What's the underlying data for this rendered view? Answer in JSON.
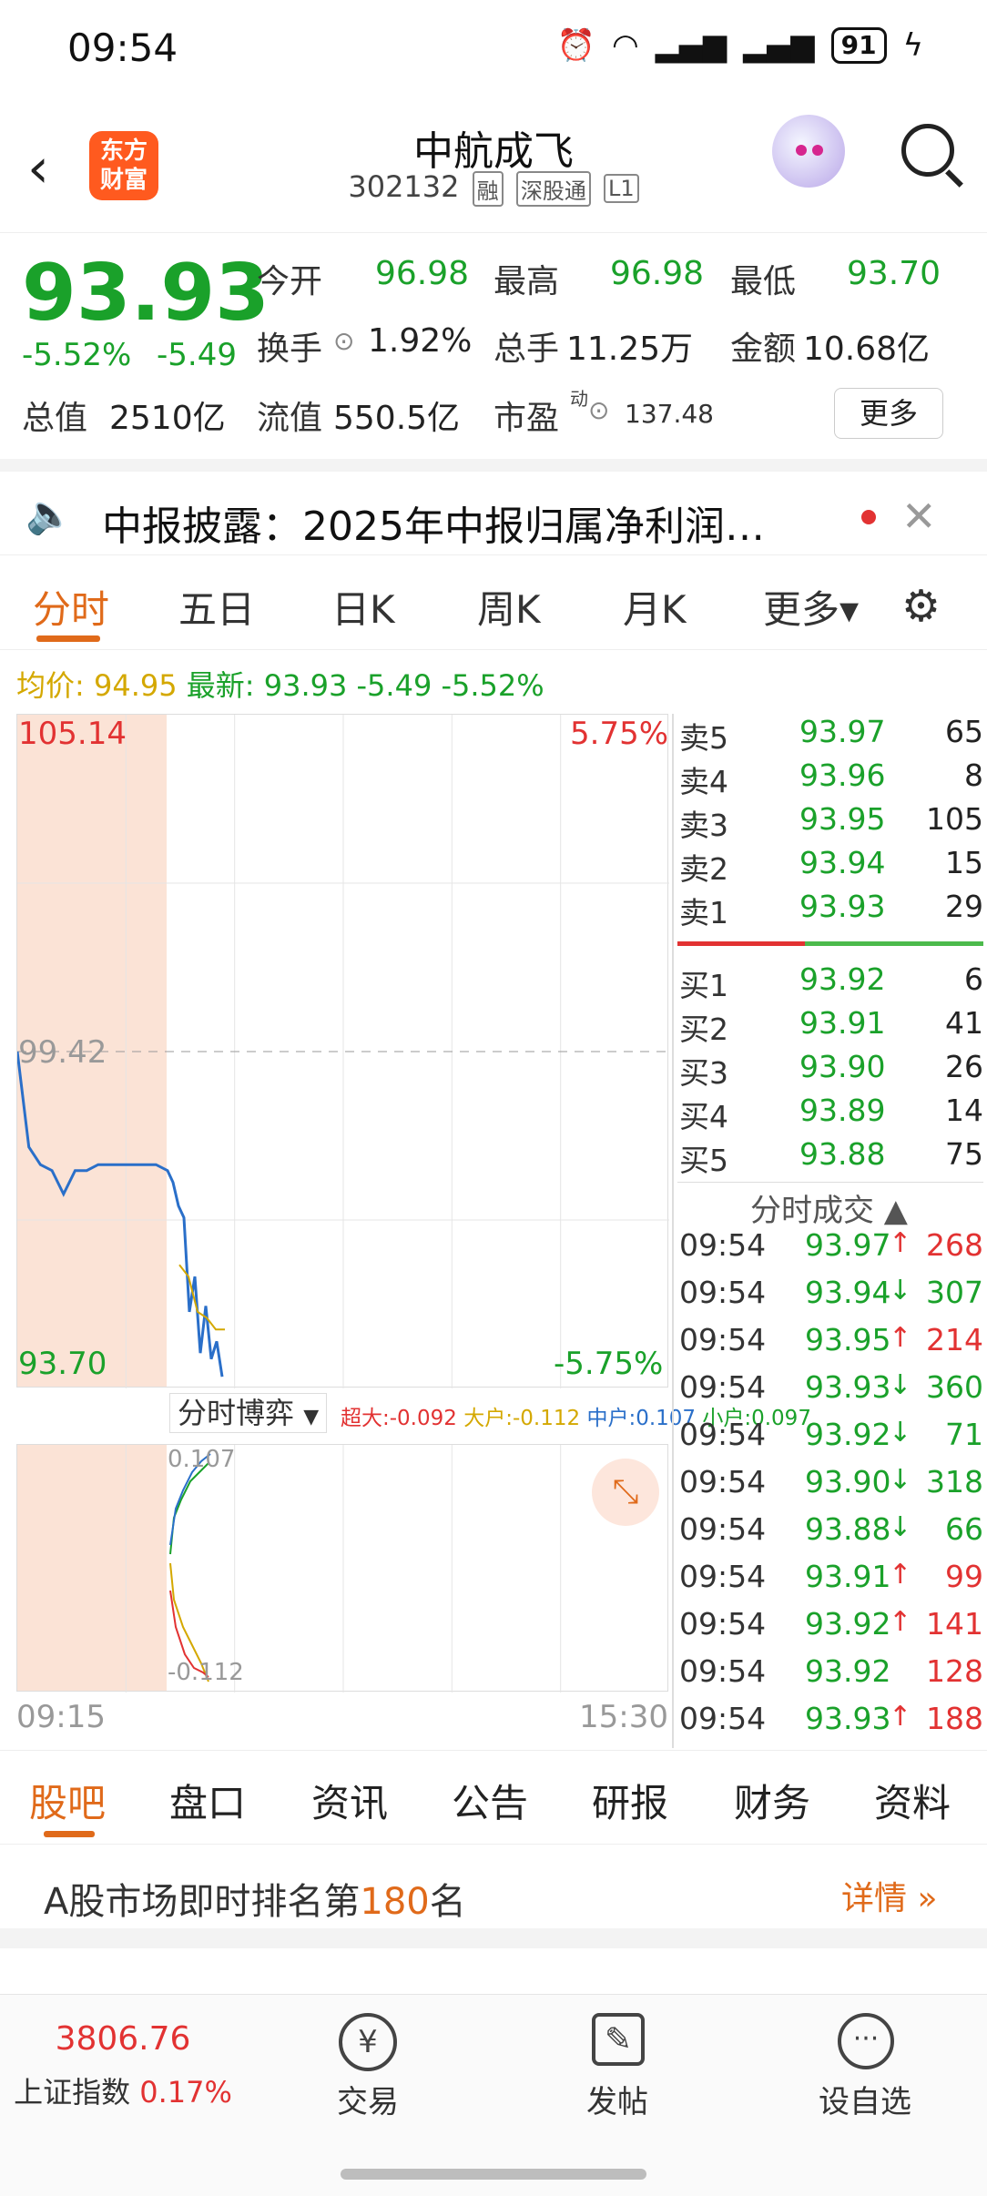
{
  "status_bar": {
    "time": "09:54",
    "battery": "91"
  },
  "header": {
    "logo_text_top": "东方",
    "logo_text_bottom": "财富",
    "stock_name": "中航成飞",
    "stock_code": "302132",
    "tags": [
      "融",
      "深股通",
      "L1"
    ]
  },
  "quote": {
    "price": "93.93",
    "change_pct": "-5.52%",
    "change": "-5.49",
    "open_label": "今开",
    "open": "96.98",
    "high_label": "最高",
    "high": "96.98",
    "low_label": "最低",
    "low": "93.70",
    "turnover_label": "换手",
    "turnover": "1.92%",
    "volume_label": "总手",
    "volume": "11.25万",
    "amount_label": "金额",
    "amount": "10.68亿",
    "mktcap_label": "总值",
    "mktcap": "2510亿",
    "float_label": "流值",
    "float": "550.5亿",
    "pe_label": "市盈",
    "pe_sup": "动",
    "pe": "137.48",
    "more_button": "更多"
  },
  "notice": {
    "text": "中报披露：2025年中报归属净利润…"
  },
  "chart_tabs": {
    "items": [
      "分时",
      "五日",
      "日K",
      "周K",
      "月K",
      "更多▾"
    ],
    "active": "分时"
  },
  "avg_line": {
    "avg_label": "均价:",
    "avg": "94.95",
    "latest_label": "最新:",
    "latest": "93.93",
    "chg": "-5.49",
    "pct": "-5.52%"
  },
  "chart_data": {
    "type": "line",
    "y_top_label": "105.14",
    "y_mid_label": "99.42",
    "y_bottom_label": "93.70",
    "pct_top_label": "5.75%",
    "pct_bottom_label": "-5.75%",
    "x_start_label": "09:15",
    "x_end_label": "15:30",
    "ylim": [
      93.7,
      105.14
    ],
    "series": [
      {
        "values": [
          99.42,
          97.8,
          97.5,
          97.4,
          97.0,
          97.4,
          97.4,
          97.5,
          97.5,
          97.5,
          97.5,
          97.5,
          97.5,
          97.4,
          97.2,
          96.8,
          96.6,
          95.0,
          95.6,
          94.3,
          95.1,
          94.2,
          94.5,
          93.9
        ]
      },
      {
        "values": [
          95.8,
          95.6,
          95.0,
          94.9,
          94.7,
          94.7
        ]
      }
    ],
    "sub_panel": {
      "selector_label": "分时博弈",
      "legend": [
        {
          "name": "超大:",
          "value": "-0.092",
          "color": "#e23232"
        },
        {
          "name": "大户:",
          "value": "-0.112",
          "color": "#d4a800"
        },
        {
          "name": "中户:",
          "value": "0.107",
          "color": "#2a6fc9"
        },
        {
          "name": "小户:",
          "value": "0.097",
          "color": "#1aa12a"
        }
      ],
      "top_label": "0.107",
      "bottom_label": "-0.112"
    }
  },
  "order_book": {
    "asks": [
      {
        "label": "卖5",
        "price": "93.97",
        "vol": "65"
      },
      {
        "label": "卖4",
        "price": "93.96",
        "vol": "8"
      },
      {
        "label": "卖3",
        "price": "93.95",
        "vol": "105"
      },
      {
        "label": "卖2",
        "price": "93.94",
        "vol": "15"
      },
      {
        "label": "卖1",
        "price": "93.93",
        "vol": "29"
      }
    ],
    "bids": [
      {
        "label": "买1",
        "price": "93.92",
        "vol": "6"
      },
      {
        "label": "买2",
        "price": "93.91",
        "vol": "41"
      },
      {
        "label": "买3",
        "price": "93.90",
        "vol": "26"
      },
      {
        "label": "买4",
        "price": "93.89",
        "vol": "14"
      },
      {
        "label": "买5",
        "price": "93.88",
        "vol": "75"
      }
    ]
  },
  "ticks": {
    "title": "分时成交 ▲",
    "rows": [
      {
        "time": "09:54",
        "price": "93.97",
        "dir": "↑",
        "vol": "268",
        "color": "#e23232"
      },
      {
        "time": "09:54",
        "price": "93.94",
        "dir": "↓",
        "vol": "307",
        "color": "#1aa12a"
      },
      {
        "time": "09:54",
        "price": "93.95",
        "dir": "↑",
        "vol": "214",
        "color": "#e23232"
      },
      {
        "time": "09:54",
        "price": "93.93",
        "dir": "↓",
        "vol": "360",
        "color": "#1aa12a"
      },
      {
        "time": "09:54",
        "price": "93.92",
        "dir": "↓",
        "vol": "71",
        "color": "#1aa12a"
      },
      {
        "time": "09:54",
        "price": "93.90",
        "dir": "↓",
        "vol": "318",
        "color": "#1aa12a"
      },
      {
        "time": "09:54",
        "price": "93.88",
        "dir": "↓",
        "vol": "66",
        "color": "#1aa12a"
      },
      {
        "time": "09:54",
        "price": "93.91",
        "dir": "↑",
        "vol": "99",
        "color": "#e23232"
      },
      {
        "time": "09:54",
        "price": "93.92",
        "dir": "↑",
        "vol": "141",
        "color": "#e23232"
      },
      {
        "time": "09:54",
        "price": "93.92",
        "dir": "",
        "vol": "128",
        "color": "#e23232"
      },
      {
        "time": "09:54",
        "price": "93.93",
        "dir": "↑",
        "vol": "188",
        "color": "#e23232"
      }
    ]
  },
  "bottom_tabs": {
    "items": [
      "股吧",
      "盘口",
      "资讯",
      "公告",
      "研报",
      "财务",
      "资料"
    ],
    "active": "股吧"
  },
  "rank": {
    "prefix": "A股市场即时排名第",
    "number": "180",
    "suffix": "名",
    "more": "详情 »"
  },
  "navbar": {
    "index_value": "3806.76",
    "index_name": "上证指数",
    "index_pct": "0.17%",
    "trade": "交易",
    "post": "发帖",
    "watch": "设自选"
  }
}
